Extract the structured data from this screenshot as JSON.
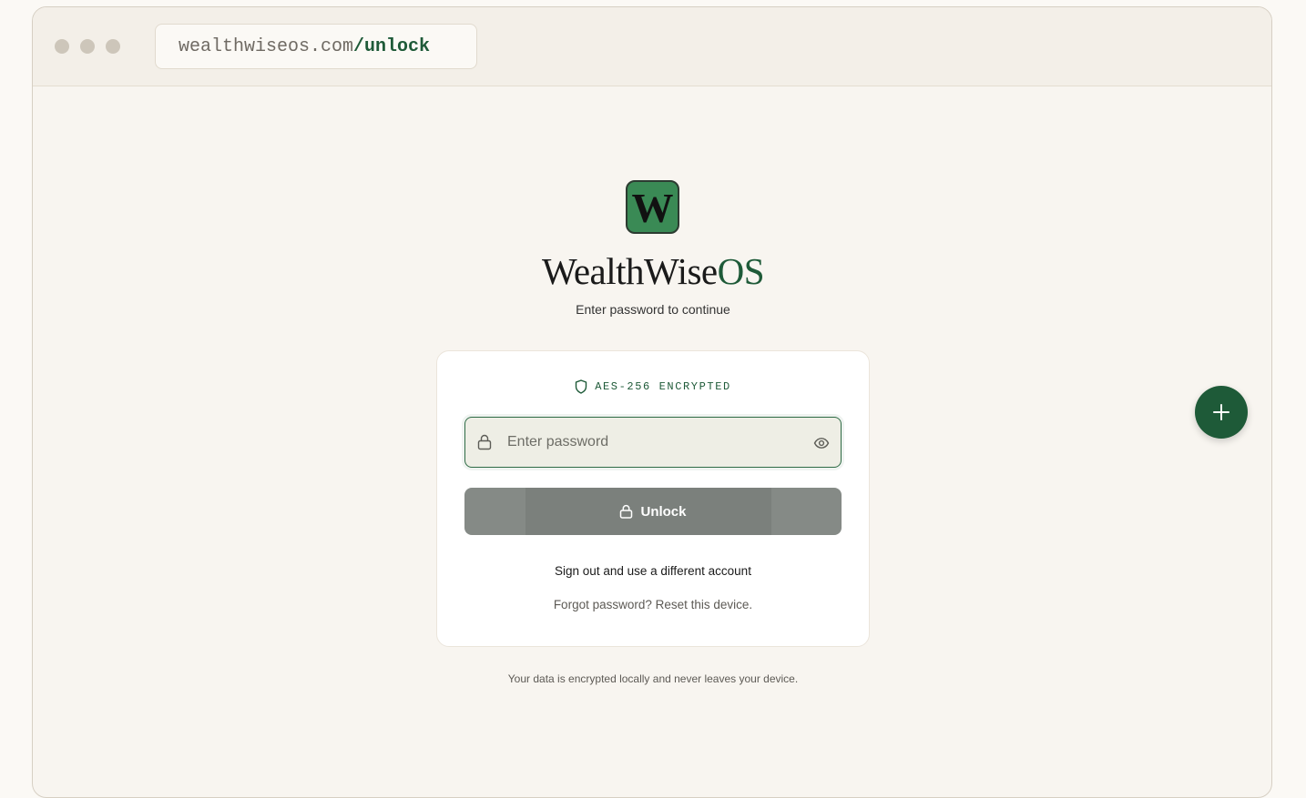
{
  "browser": {
    "url_domain": "wealthwiseos.com",
    "url_path": "/unlock"
  },
  "app": {
    "logo_letter": "W",
    "brand_main": "WealthWise",
    "brand_accent": "OS",
    "subtitle": "Enter password to continue"
  },
  "card": {
    "encryption_label": "AES-256 ENCRYPTED",
    "password": {
      "value": "",
      "placeholder": "Enter password"
    },
    "unlock_label": "Unlock",
    "sign_out_label": "Sign out and use a different account",
    "forgot_label": "Forgot password? Reset this device."
  },
  "footer": {
    "note": "Your data is encrypted locally and never leaves your device."
  },
  "icons": {
    "shield": "shield-icon",
    "lock": "lock-icon",
    "eye": "eye-icon",
    "plus": "plus-icon"
  },
  "colors": {
    "accent": "#1e5a38",
    "logo_bg": "#3a8a55",
    "button_disabled": "#858a86",
    "background": "#f8f5f0"
  }
}
